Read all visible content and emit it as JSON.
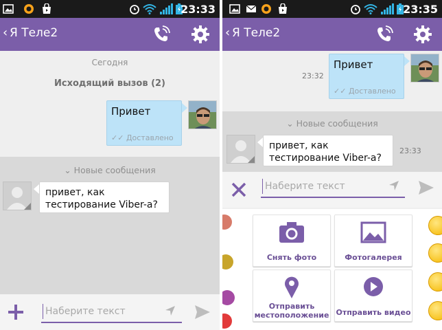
{
  "left": {
    "status_time": "23:33",
    "title": "Я Теле2",
    "date_label": "Сегодня",
    "call_log": "Исходящий вызов (2)",
    "out_message": {
      "text": "Привет",
      "status": "Доставлено"
    },
    "new_messages_label": "Новые сообщения",
    "in_message": {
      "line1": "привет, как",
      "line2": "тестирование Viber-а?"
    },
    "input_placeholder": "Наберите текст"
  },
  "right": {
    "status_time": "23:35",
    "title": "Я Теле2",
    "out_message": {
      "text": "Привет",
      "status": "Доставлено",
      "time": "23:32"
    },
    "new_messages_label": "Новые сообщения",
    "in_message": {
      "line1": "привет, как",
      "line2": "тестирование Viber-а?",
      "time": "23:33"
    },
    "input_placeholder": "Наберите текст",
    "attachments": [
      {
        "label": "Снять фото",
        "icon": "camera-icon"
      },
      {
        "label": "Фотогалерея",
        "icon": "gallery-icon"
      },
      {
        "label_line1": "Отправить",
        "label_line2": "местоположение",
        "icon": "location-icon"
      },
      {
        "label": "Отправить видео",
        "icon": "video-icon"
      }
    ]
  },
  "colors": {
    "accent": "#7b5ea9",
    "bubble_out": "#bde3f8",
    "status_bar": "#1a1a1a"
  }
}
